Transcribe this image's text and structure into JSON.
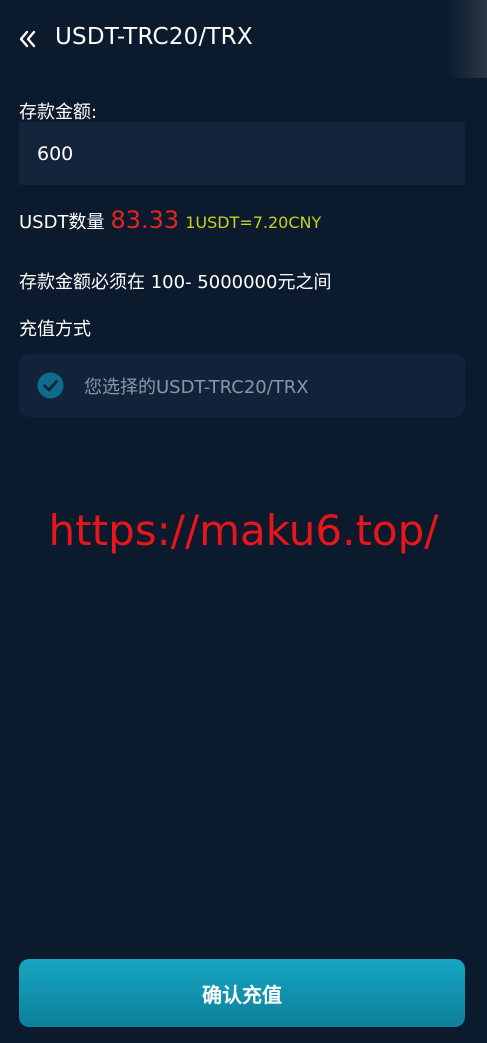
{
  "header": {
    "title": "USDT-TRC20/TRX",
    "back_icon": "double-chevron-left-icon"
  },
  "deposit": {
    "amount_label": "存款金额:",
    "amount_value": "600",
    "usdt_label": "USDT数量",
    "usdt_value": "83.33",
    "rate_text": "1USDT=7.20CNY",
    "range_text": "存款金额必须在 100- 5000000元之间"
  },
  "method": {
    "label": "充值方式",
    "selected_text": "您选择的USDT-TRC20/TRX",
    "check_icon": "check-circle-icon"
  },
  "watermark": {
    "text": "https://maku6.top/"
  },
  "actions": {
    "confirm_label": "确认充值"
  },
  "colors": {
    "background": "#0c1a2e",
    "field_bg": "#13233a",
    "usdt_value": "#e8241f",
    "rate": "#c6d21a",
    "watermark": "#e8161a",
    "button_top": "#16a6c2",
    "button_bottom": "#0d7f9a",
    "check": "#0f6b8a"
  }
}
